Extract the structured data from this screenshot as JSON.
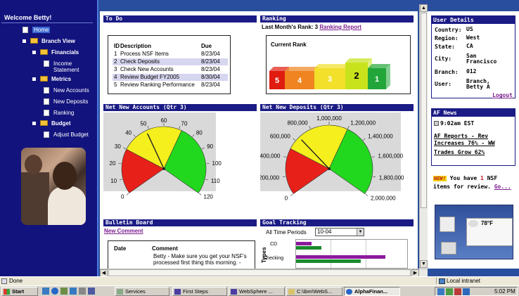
{
  "nav": {
    "welcome": "Welcome Betty!",
    "items": [
      {
        "label": "Home",
        "kind": "doc",
        "bold": false
      },
      {
        "label": "Branch View",
        "kind": "folder",
        "bold": true
      },
      {
        "label": "Financials",
        "kind": "folder",
        "bold": true
      },
      {
        "label": "Income Statement",
        "kind": "doc",
        "bold": false
      },
      {
        "label": "Metrics",
        "kind": "folder",
        "bold": true
      },
      {
        "label": "New Accounts",
        "kind": "doc",
        "bold": false
      },
      {
        "label": "New Deposits",
        "kind": "doc",
        "bold": false
      },
      {
        "label": "Ranking",
        "kind": "doc",
        "bold": false
      },
      {
        "label": "Budget",
        "kind": "folder",
        "bold": true
      },
      {
        "label": "Adjust Budget",
        "kind": "doc",
        "bold": false
      }
    ]
  },
  "todo": {
    "title": "To Do",
    "headers": {
      "id": "ID",
      "desc": "Description",
      "due": "Due"
    },
    "rows": [
      {
        "id": "1",
        "desc": "Process NSF Items",
        "due": "8/23/04",
        "selected": false
      },
      {
        "id": "2",
        "desc": "Check Deposits",
        "due": "8/23/04",
        "selected": true
      },
      {
        "id": "3",
        "desc": "Check New Accounts",
        "due": "8/23/04",
        "selected": false
      },
      {
        "id": "4",
        "desc": "Review Budget FY2005",
        "due": "8/30/04",
        "selected": true
      },
      {
        "id": "5",
        "desc": "Review Ranking Performance",
        "due": "8/23/04",
        "selected": false
      }
    ]
  },
  "ranking": {
    "title": "Ranking",
    "last_month_label": "Last Month's Rank: 3",
    "report_link": "Ranking Report",
    "current_rank_label": "Current Rank",
    "blocks": [
      {
        "value": "5",
        "color": "#e01b10"
      },
      {
        "value": "4",
        "color": "#ef8420"
      },
      {
        "value": "3",
        "color": "#f2e02a"
      },
      {
        "value": "2",
        "color": "#c8e31c"
      },
      {
        "value": "1",
        "color": "#22a63a"
      }
    ],
    "current": "2"
  },
  "accounts_gauge": {
    "title": "Net New Accounts (Qtr 3)",
    "ticks": [
      "0",
      "10",
      "20",
      "30",
      "40",
      "50",
      "60",
      "70",
      "80",
      "90",
      "100",
      "110",
      "120"
    ],
    "value": 48,
    "max": 120
  },
  "deposits_gauge": {
    "title": "Net New Deposits (Qtr 3)",
    "ticks": [
      "0",
      "200,000",
      "400,000",
      "600,000",
      "800,000",
      "1,000,000",
      "1,200,000",
      "1,400,000",
      "1,600,000",
      "1,800,000",
      "2,000,000"
    ],
    "value": 650000,
    "max": 2000000
  },
  "bulletin": {
    "title": "Bulletin Board",
    "new_comment": "New Comment",
    "col_date": "Date",
    "col_comment": "Comment",
    "comment_text": "Betty - Make sure you get your NSF's processed first thing this morning. -"
  },
  "goal": {
    "title": "Goal Tracking",
    "period_label": "All Time Periods",
    "period_value": "10-04",
    "axis_label": "Types",
    "categories": [
      "CD",
      "Checking"
    ]
  },
  "user": {
    "title": "User Details",
    "country_k": "Country:",
    "country_v": "US",
    "region_k": "Region:",
    "region_v": "West",
    "state_k": "State:",
    "state_v": "CA",
    "city_k": "City:",
    "city_v1": "San",
    "city_v2": "Francisco",
    "branch_k": "Branch:",
    "branch_v": "012",
    "user_k": "User:",
    "user_v1": "Branch,",
    "user_v2": "Betty A",
    "logout": "Logout"
  },
  "news": {
    "title": "AF News",
    "time": "9:02am EST",
    "headline1": "AF Reports - Rev Increases 76% - WW",
    "headline2": "Trades Grow 62%"
  },
  "nsf": {
    "new_badge": "NEW!",
    "pre": "You have",
    "count": "1",
    "post": "NSF items for review.",
    "go": "Go..."
  },
  "weather": {
    "temp": "78°F"
  },
  "status": {
    "left": "Done",
    "right": "Local intranet"
  },
  "taskbar": {
    "start": "Start",
    "buttons": [
      "Services",
      "First Steps",
      "WebSphere ...",
      "C:\\ibm\\WebS...",
      "AlphaFinan..."
    ],
    "clock": "5:02 PM"
  }
}
